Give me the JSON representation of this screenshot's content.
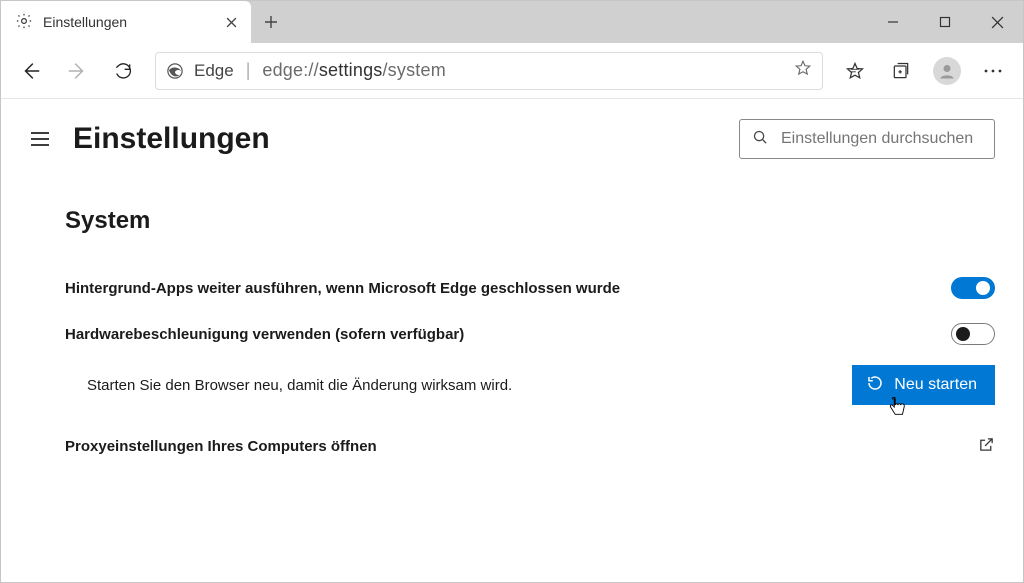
{
  "window": {
    "tab_title": "Einstellungen",
    "edge_label": "Edge",
    "url_host": "edge://",
    "url_path_pre": "settings",
    "url_path_post": "/system"
  },
  "header": {
    "page_title": "Einstellungen",
    "search_placeholder": "Einstellungen durchsuchen"
  },
  "section": {
    "title": "System",
    "rows": {
      "bg_apps": "Hintergrund-Apps weiter ausführen, wenn Microsoft Edge geschlossen wurde",
      "hw_accel": "Hardwarebeschleunigung verwenden (sofern verfügbar)",
      "restart_hint": "Starten Sie den Browser neu, damit die Änderung wirksam wird.",
      "restart_button": "Neu starten",
      "proxy": "Proxyeinstellungen Ihres Computers öffnen"
    },
    "states": {
      "bg_apps_enabled": true,
      "hw_accel_enabled": false
    }
  }
}
